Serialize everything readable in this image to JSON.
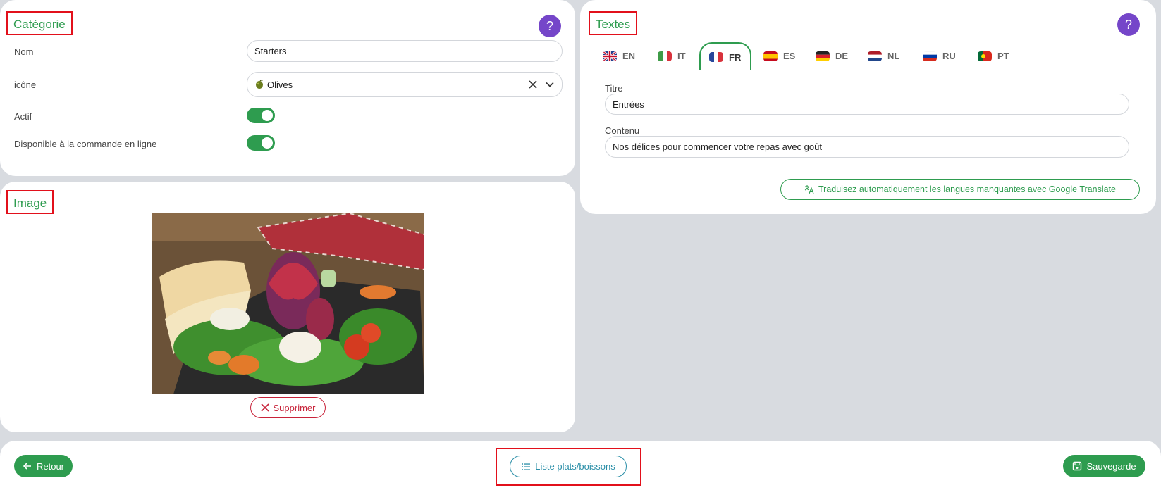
{
  "category": {
    "title": "Catégorie",
    "help": "?",
    "name_label": "Nom",
    "name_value": "Starters",
    "icon_label": "icône",
    "icon_value": "Olives",
    "active_label": "Actif",
    "online_label": "Disponible à la commande en ligne",
    "active": true,
    "online": true
  },
  "image_section": {
    "title": "Image",
    "delete_label": "Supprimer"
  },
  "texts": {
    "title": "Textes",
    "help": "?",
    "tabs": [
      {
        "code": "EN",
        "flag": "gb-flag-icon"
      },
      {
        "code": "IT",
        "flag": "it-flag-icon"
      },
      {
        "code": "FR",
        "flag": "fr-flag-icon",
        "active": true
      },
      {
        "code": "ES",
        "flag": "es-flag-icon"
      },
      {
        "code": "DE",
        "flag": "de-flag-icon"
      },
      {
        "code": "NL",
        "flag": "nl-flag-icon"
      },
      {
        "code": "RU",
        "flag": "ru-flag-icon"
      },
      {
        "code": "PT",
        "flag": "pt-flag-icon"
      }
    ],
    "title_label": "Titre",
    "title_value": "Entrées",
    "content_label": "Contenu",
    "content_value": "Nos délices pour commencer votre repas avec goût",
    "translate_label": "Traduisez automatiquement les langues manquantes avec Google Translate"
  },
  "footer": {
    "back_label": "Retour",
    "list_label": "Liste plats/boissons",
    "save_label": "Sauvegarde"
  },
  "colors": {
    "accent_green": "#2e9c4f",
    "help_purple": "#7546c9",
    "annotation_red": "#e2101b",
    "danger_red": "#c8233a",
    "teal": "#2b8fa8",
    "background": "#d8dbe0"
  }
}
